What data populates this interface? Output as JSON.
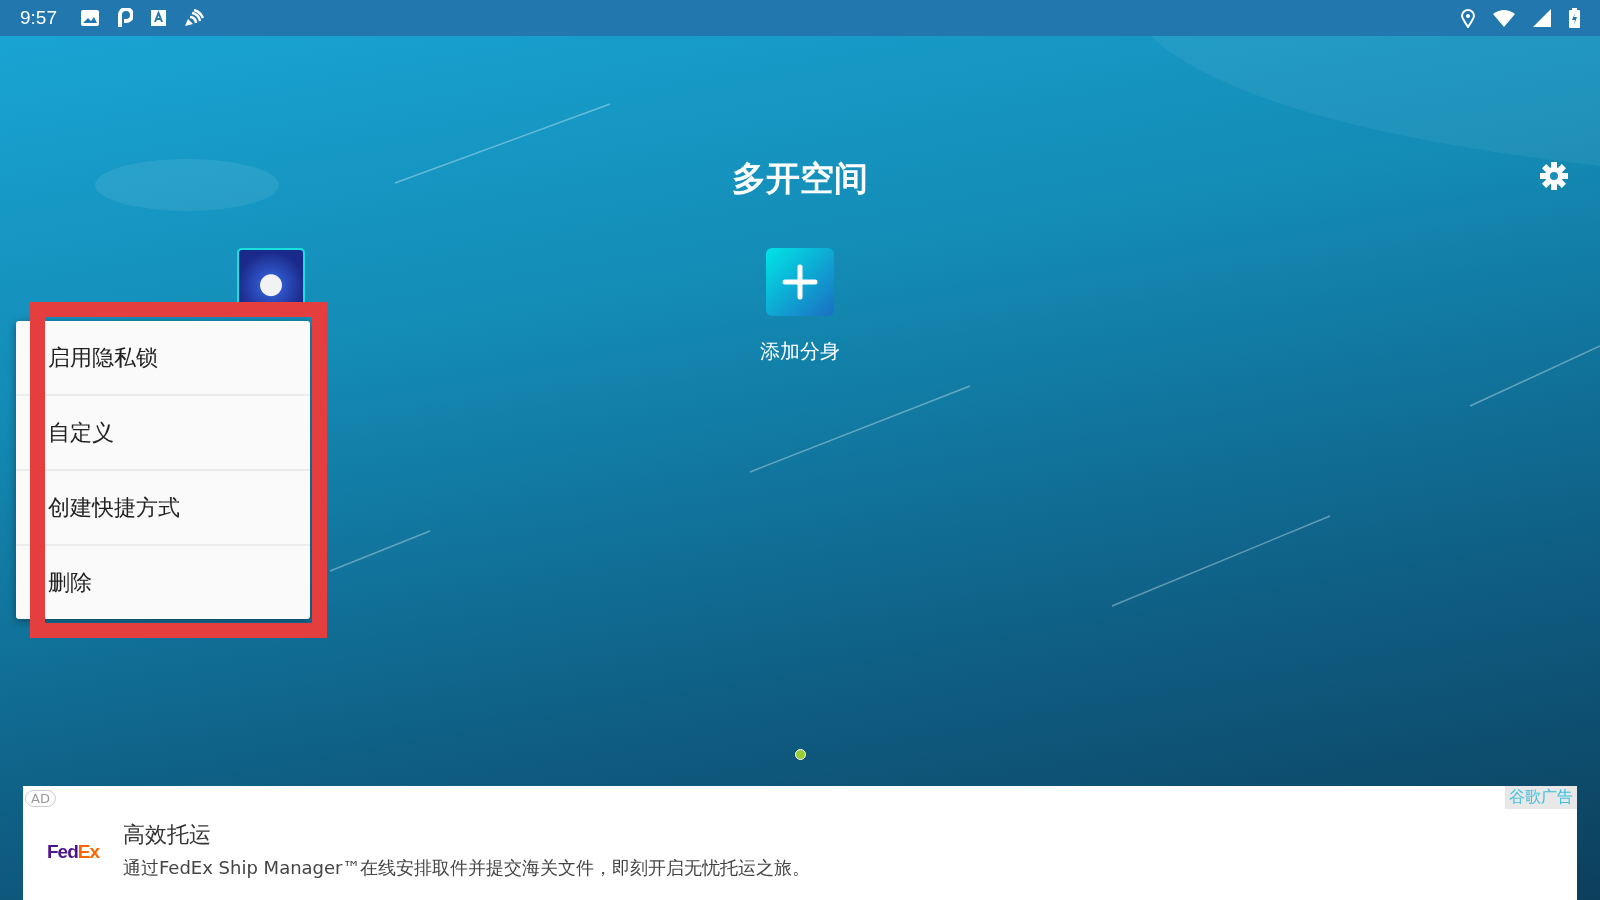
{
  "status_bar": {
    "time": "9:57"
  },
  "header": {
    "title": "多开空间"
  },
  "add_clone": {
    "label": "添加分身"
  },
  "pager": [
    {
      "selected": true
    }
  ],
  "context_menu": {
    "items": [
      "启用隐私锁",
      "自定义",
      "创建快捷方式",
      "删除"
    ]
  },
  "ad": {
    "badge": "AD",
    "source": "谷歌广告",
    "logo": "FedEx",
    "title": "高效托运",
    "body": "通过FedEx Ship Manager™在线安排取件并提交海关文件，即刻开启无忧托运之旅。"
  }
}
